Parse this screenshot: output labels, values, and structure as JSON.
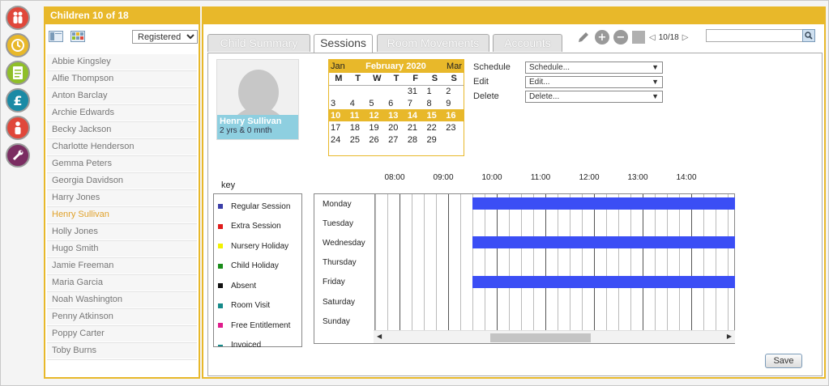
{
  "left_rail": {
    "icons": [
      {
        "name": "family-icon",
        "color": "#e0473a"
      },
      {
        "name": "sessions-icon",
        "color": "#e8b82a"
      },
      {
        "name": "notes-icon",
        "color": "#8fbf28"
      },
      {
        "name": "finance-icon",
        "color": "#1b8aa5"
      },
      {
        "name": "staff-icon",
        "color": "#e0473a"
      },
      {
        "name": "settings-icon",
        "color": "#7b2d62"
      }
    ]
  },
  "children_panel": {
    "title": "Children 10 of 18",
    "filter_value": "Registered",
    "children": [
      "Abbie Kingsley",
      "Alfie Thompson",
      "Anton Barclay",
      "Archie Edwards",
      "Becky Jackson",
      "Charlotte Henderson",
      "Gemma Peters",
      "Georgia Davidson",
      "Harry Jones",
      "Henry Sullivan",
      "Holly Jones",
      "Hugo Smith",
      "Jamie Freeman",
      "Maria Garcia",
      "Noah Washington",
      "Penny Atkinson",
      "Poppy Carter",
      "Toby Burns"
    ],
    "selected_child": "Henry Sullivan"
  },
  "tabs": [
    "Child Summary",
    "Sessions",
    "Room Movements",
    "Accounts"
  ],
  "active_tab": "Sessions",
  "toolbar": {
    "page_indicator": "10/18",
    "search_value": ""
  },
  "child_card": {
    "name": "Henry Sullivan",
    "age": "2 yrs & 0 mnth"
  },
  "calendar": {
    "prev_month": "Jan",
    "month_title": "February 2020",
    "next_month": "Mar",
    "weekday_headers": [
      "M",
      "T",
      "W",
      "T",
      "F",
      "S",
      "S"
    ],
    "weeks": [
      [
        "",
        "",
        "",
        "",
        "31",
        "1",
        "2"
      ],
      [
        "3",
        "4",
        "5",
        "6",
        "7",
        "8",
        "9"
      ],
      [
        "10",
        "11",
        "12",
        "13",
        "14",
        "15",
        "16"
      ],
      [
        "17",
        "18",
        "19",
        "20",
        "21",
        "22",
        "23"
      ],
      [
        "24",
        "25",
        "26",
        "27",
        "28",
        "29",
        ""
      ]
    ],
    "highlighted_week_index": 2
  },
  "actions": [
    {
      "label": "Schedule",
      "value": "Schedule..."
    },
    {
      "label": "Edit",
      "value": "Edit..."
    },
    {
      "label": "Delete",
      "value": "Delete..."
    }
  ],
  "key_title": "key",
  "key": [
    {
      "label": "Regular Session",
      "color": "#3b3ea8"
    },
    {
      "label": "Extra Session",
      "color": "#e01c1c"
    },
    {
      "label": "Nursery Holiday",
      "color": "#f2f200"
    },
    {
      "label": "Child Holiday",
      "color": "#1a8c1a"
    },
    {
      "label": "Absent",
      "color": "#111111"
    },
    {
      "label": "Room Visit",
      "color": "#168a8a"
    },
    {
      "label": "Free Entitlement",
      "color": "#e01c8c"
    },
    {
      "label": "Invoiced",
      "color": "#168a8a"
    }
  ],
  "schedule": {
    "time_labels": [
      "08:00",
      "09:00",
      "10:00",
      "11:00",
      "12:00",
      "13:00",
      "14:00"
    ],
    "days": [
      "Monday",
      "Tuesday",
      "Wednesday",
      "Thursday",
      "Friday",
      "Saturday",
      "Sunday"
    ],
    "sessions": [
      {
        "day": "Monday",
        "start": "09:30",
        "type": "Regular Session"
      },
      {
        "day": "Wednesday",
        "start": "09:30",
        "type": "Regular Session"
      },
      {
        "day": "Friday",
        "start": "09:30",
        "type": "Regular Session"
      }
    ]
  },
  "save_label": "Save"
}
